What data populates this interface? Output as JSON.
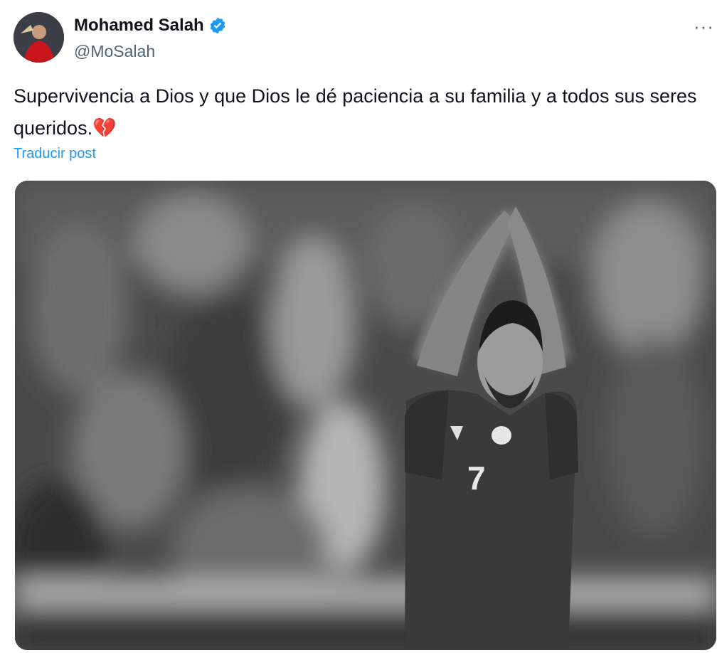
{
  "author": {
    "display_name": "Mohamed Salah",
    "handle": "@MoSalah",
    "avatar_icon": "avatar-photo",
    "verified_icon": "verified-badge-icon"
  },
  "more_label": "···",
  "tweet": {
    "text": "Supervivencia a Dios y que Dios le dé paciencia a su familia y a todos sus seres queridos.💔",
    "translate_label": "Traducir post"
  },
  "media": {
    "kind": "photo",
    "jersey_number": "7"
  },
  "colors": {
    "link": "#1d9bf0",
    "verified": "#1d9bf0",
    "secondary_text": "#536471"
  }
}
